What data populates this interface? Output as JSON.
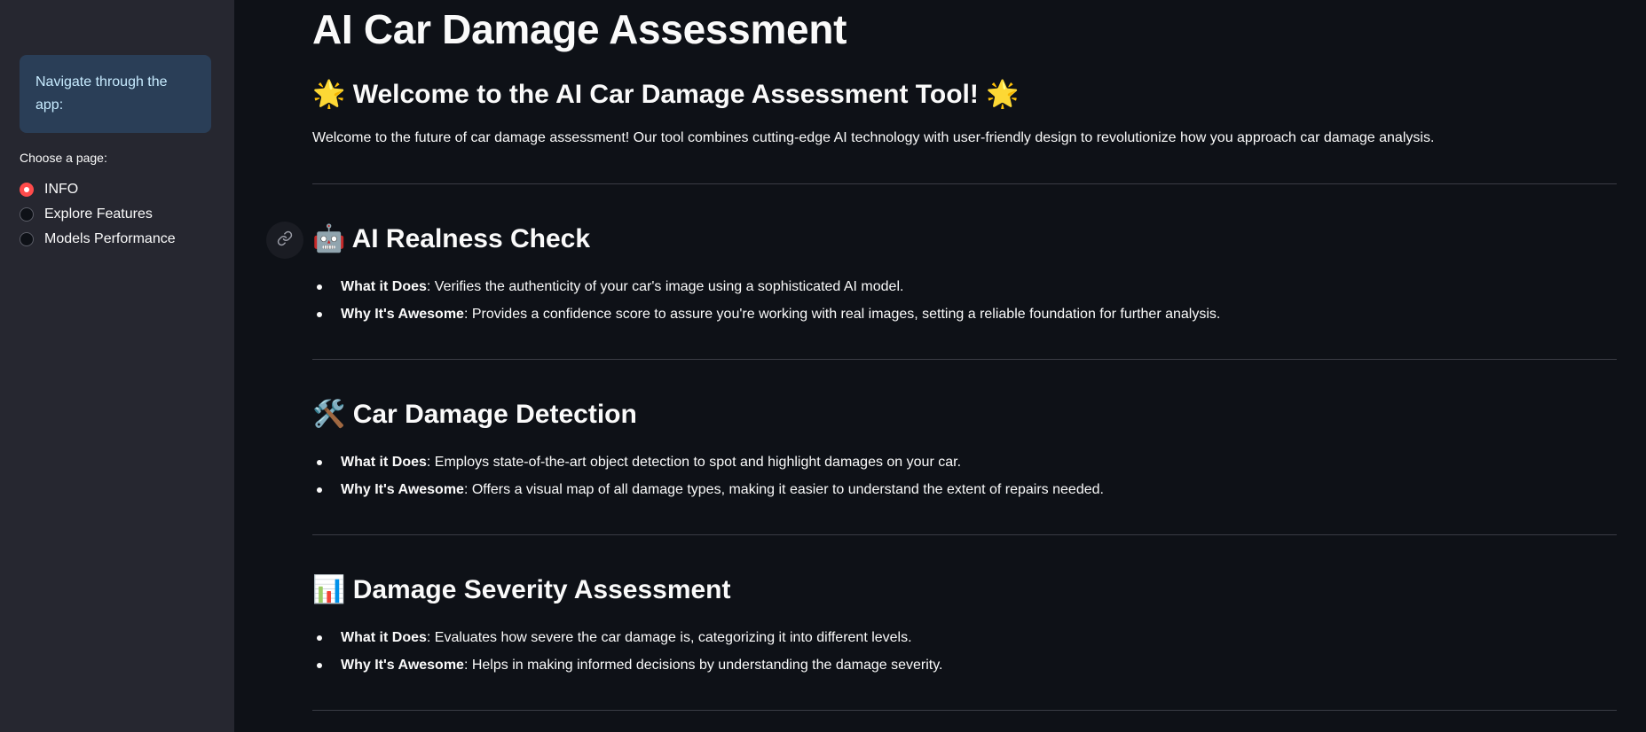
{
  "sidebar": {
    "info_text": "Navigate through the app:",
    "radio_title": "Choose a page:",
    "options": [
      {
        "label": "INFO",
        "selected": true
      },
      {
        "label": "Explore Features",
        "selected": false
      },
      {
        "label": "Models Performance",
        "selected": false
      }
    ]
  },
  "main": {
    "title": "AI Car Damage Assessment",
    "welcome_heading": {
      "emoji": "🌟",
      "text": "Welcome to the AI Car Damage Assessment Tool!"
    },
    "welcome_paragraph": "Welcome to the future of car damage assessment! Our tool combines cutting-edge AI technology with user-friendly design to revolutionize how you approach car damage analysis.",
    "sections": [
      {
        "emoji": "🤖",
        "heading": "AI Realness Check",
        "items": [
          {
            "label": "What it Does",
            "text": ": Verifies the authenticity of your car's image using a sophisticated AI model."
          },
          {
            "label": "Why It's Awesome",
            "text": ": Provides a confidence score to assure you're working with real images, setting a reliable foundation for further analysis."
          }
        ]
      },
      {
        "emoji": "🛠️",
        "heading": "Car Damage Detection",
        "items": [
          {
            "label": "What it Does",
            "text": ": Employs state-of-the-art object detection to spot and highlight damages on your car."
          },
          {
            "label": "Why It's Awesome",
            "text": ": Offers a visual map of all damage types, making it easier to understand the extent of repairs needed."
          }
        ]
      },
      {
        "emoji": "📊",
        "heading": "Damage Severity Assessment",
        "items": [
          {
            "label": "What it Does",
            "text": ": Evaluates how severe the car damage is, categorizing it into different levels."
          },
          {
            "label": "Why It's Awesome",
            "text": ": Helps in making informed decisions by understanding the damage severity."
          }
        ]
      }
    ]
  },
  "colors": {
    "background": "#0e1117",
    "sidebar": "#262730",
    "accent": "#ff4b4b",
    "info_text": "#c7ebff"
  }
}
